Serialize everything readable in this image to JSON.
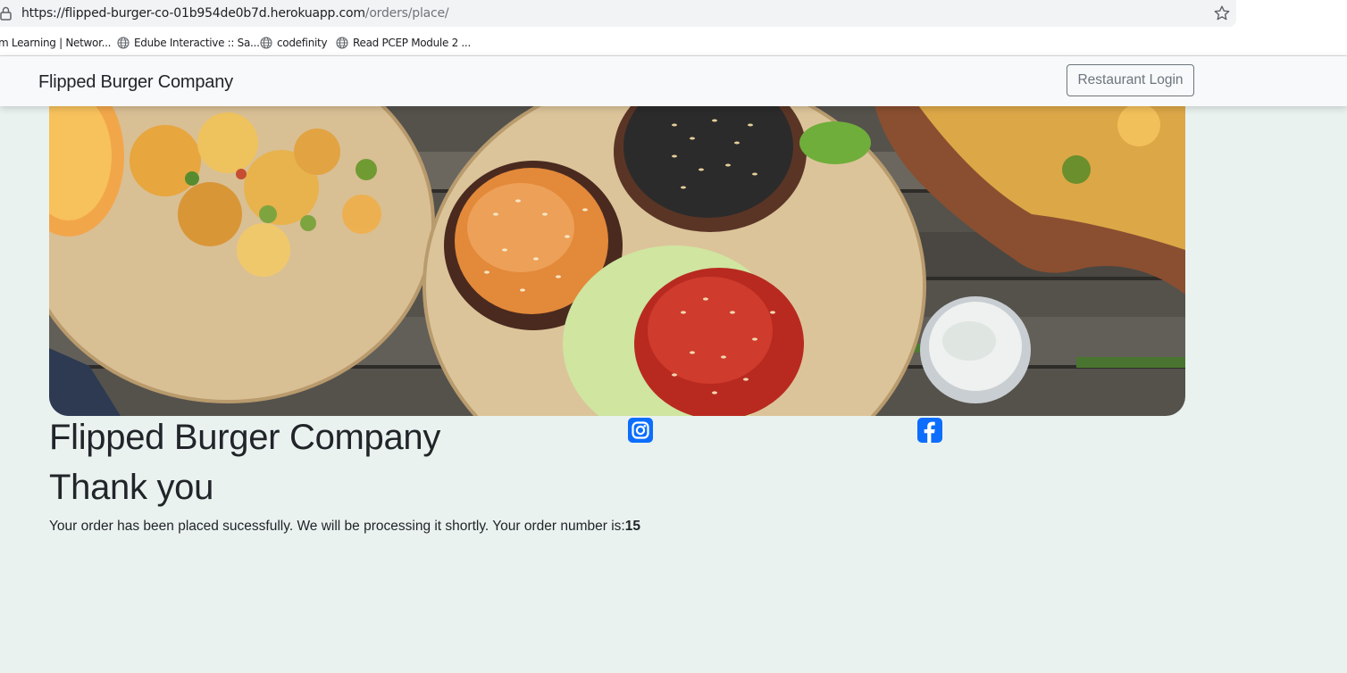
{
  "browser": {
    "url_scheme": "https://",
    "url_host": "flipped-burger-co-01b954de0b7d.herokuapp.com",
    "url_path": "/orders/place/",
    "bookmarks": [
      {
        "label": "m Learning | Networ...",
        "icon": "none"
      },
      {
        "label": "Edube Interactive :: Sa...",
        "icon": "globe-icon"
      },
      {
        "label": "codefinity",
        "icon": "globe-icon"
      },
      {
        "label": "Read PCEP Module 2 ...",
        "icon": "globe-icon"
      }
    ]
  },
  "navbar": {
    "brand": "Flipped Burger Company",
    "login_label": "Restaurant Login"
  },
  "hero": {
    "image_name": "burger-table-banner"
  },
  "content": {
    "site_title": "Flipped Burger Company",
    "heading": "Thank you",
    "message": "Your order has been placed sucessfully. We will be processing it shortly. Your order number is:",
    "order_number": "15"
  },
  "social": {
    "instagram": "instagram-icon",
    "facebook": "facebook-icon"
  },
  "colors": {
    "page_background": "#eaf2f0",
    "navbar_background": "#f8f9fa",
    "social_icon": "#0d6efd",
    "login_border": "#6c757d"
  }
}
